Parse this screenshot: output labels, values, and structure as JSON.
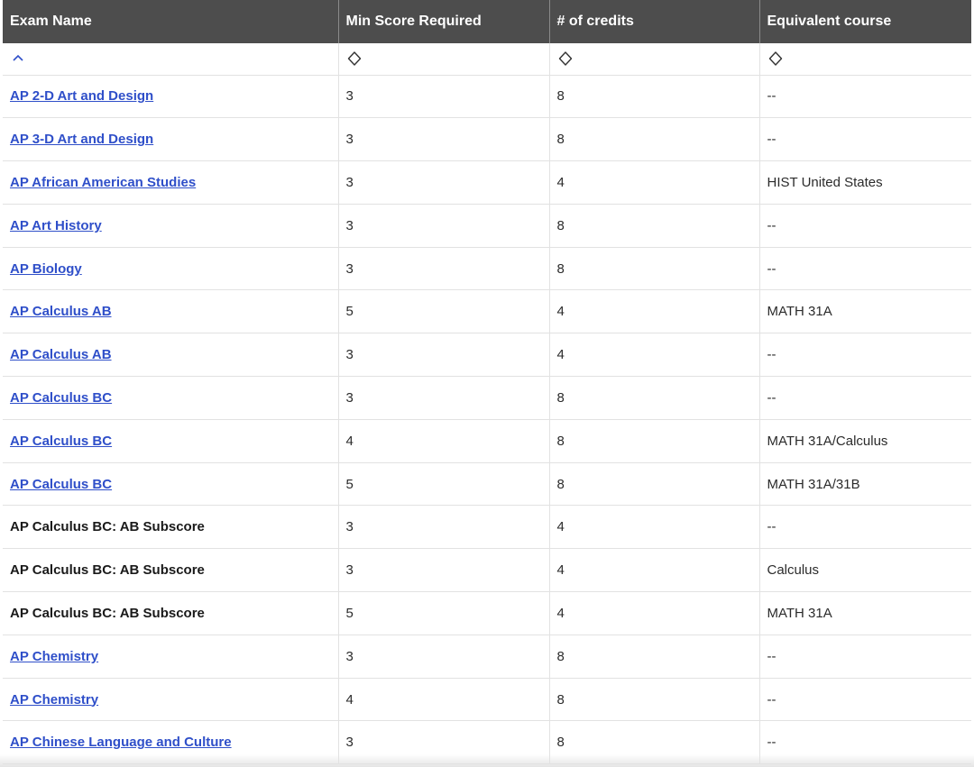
{
  "table": {
    "headers": [
      "Exam Name",
      "Min Score Required",
      "# of credits",
      "Equivalent course"
    ],
    "sort_icons": [
      "chevron-up-icon",
      "sort-icon",
      "sort-icon",
      "sort-icon"
    ],
    "accent_color": "#2f4fc9",
    "header_bg": "#4d4d4d",
    "rows": [
      {
        "exam": "AP 2-D Art and Design",
        "link": true,
        "min_score": "3",
        "credits": "8",
        "equivalent": "--"
      },
      {
        "exam": "AP 3-D Art and Design",
        "link": true,
        "min_score": "3",
        "credits": "8",
        "equivalent": "--"
      },
      {
        "exam": "AP African American Studies",
        "link": true,
        "min_score": "3",
        "credits": "4",
        "equivalent": "HIST United States"
      },
      {
        "exam": "AP Art History",
        "link": true,
        "min_score": "3",
        "credits": "8",
        "equivalent": "--"
      },
      {
        "exam": "AP Biology",
        "link": true,
        "min_score": "3",
        "credits": "8",
        "equivalent": "--"
      },
      {
        "exam": "AP Calculus AB",
        "link": true,
        "min_score": "5",
        "credits": "4",
        "equivalent": "MATH 31A"
      },
      {
        "exam": "AP Calculus AB",
        "link": true,
        "min_score": "3",
        "credits": "4",
        "equivalent": "--"
      },
      {
        "exam": "AP Calculus BC",
        "link": true,
        "min_score": "3",
        "credits": "8",
        "equivalent": "--"
      },
      {
        "exam": "AP Calculus BC",
        "link": true,
        "min_score": "4",
        "credits": "8",
        "equivalent": "MATH 31A/Calculus"
      },
      {
        "exam": "AP Calculus BC",
        "link": true,
        "min_score": "5",
        "credits": "8",
        "equivalent": "MATH 31A/31B"
      },
      {
        "exam": "AP Calculus BC: AB Subscore",
        "link": false,
        "min_score": "3",
        "credits": "4",
        "equivalent": "--"
      },
      {
        "exam": "AP Calculus BC: AB Subscore",
        "link": false,
        "min_score": "3",
        "credits": "4",
        "equivalent": "Calculus"
      },
      {
        "exam": "AP Calculus BC: AB Subscore",
        "link": false,
        "min_score": "5",
        "credits": "4",
        "equivalent": "MATH 31A"
      },
      {
        "exam": "AP Chemistry",
        "link": true,
        "min_score": "3",
        "credits": "8",
        "equivalent": "--"
      },
      {
        "exam": "AP Chemistry",
        "link": true,
        "min_score": "4",
        "credits": "8",
        "equivalent": "--"
      },
      {
        "exam": "AP Chinese Language and Culture",
        "link": true,
        "min_score": "3",
        "credits": "8",
        "equivalent": "--"
      }
    ]
  }
}
